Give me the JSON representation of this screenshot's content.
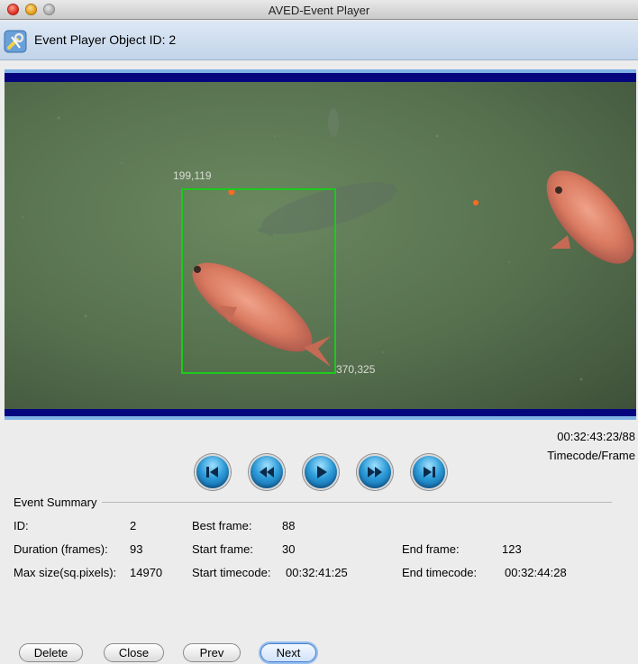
{
  "window": {
    "title": "AVED-Event Player"
  },
  "header": {
    "title": "Event Player Object ID: 2",
    "icon": "wrench-screwdriver-icon"
  },
  "video": {
    "bbox_top_left_label": "199,119",
    "bbox_bottom_right_label": "370,325",
    "bbox_color": "#1ec81e"
  },
  "playback": {
    "timecode": "00:32:43:23/88",
    "mode_label": "Timecode/Frame",
    "controls": [
      {
        "name": "skip-to-start",
        "icon": "skip-back-icon"
      },
      {
        "name": "rewind",
        "icon": "rewind-icon"
      },
      {
        "name": "play",
        "icon": "play-icon"
      },
      {
        "name": "fast-forward",
        "icon": "fast-forward-icon"
      },
      {
        "name": "skip-to-end",
        "icon": "skip-forward-icon"
      }
    ]
  },
  "summary": {
    "section_title": "Event Summary",
    "id_label": "ID:",
    "id_value": "2",
    "best_frame_label": "Best frame:",
    "best_frame_value": "88",
    "duration_label": "Duration (frames):",
    "duration_value": "93",
    "start_frame_label": "Start frame:",
    "start_frame_value": "30",
    "end_frame_label": "End frame:",
    "end_frame_value": "123",
    "max_size_label": "Max size(sq.pixels):",
    "max_size_value": "14970",
    "start_timecode_label": "Start timecode:",
    "start_timecode_value": "00:32:41:25",
    "end_timecode_label": "End timecode:",
    "end_timecode_value": "00:32:44:28"
  },
  "buttons": {
    "delete": "Delete",
    "close": "Close",
    "prev": "Prev",
    "next": "Next"
  }
}
